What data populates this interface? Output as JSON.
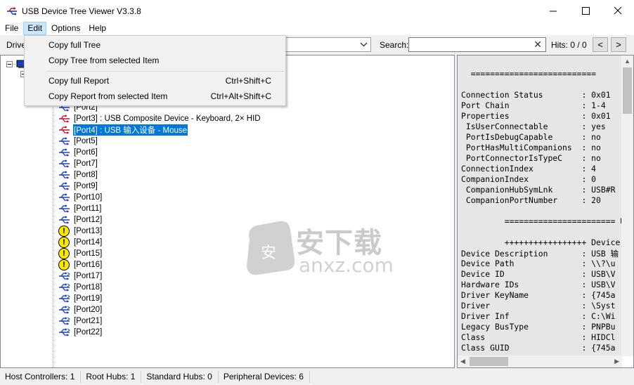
{
  "window": {
    "title": "USB Device Tree Viewer V3.3.8",
    "minimize_label": "—",
    "maximize_label": "☐",
    "close_label": "✕"
  },
  "menu": {
    "items": [
      "File",
      "Edit",
      "Options",
      "Help"
    ],
    "active_index": 1
  },
  "edit_menu": {
    "items": [
      {
        "label": "Copy full Tree",
        "shortcut": ""
      },
      {
        "label": "Copy Tree from selected Item",
        "shortcut": ""
      },
      {
        "label": "Copy full Report",
        "shortcut": "Ctrl+Shift+C"
      },
      {
        "label": "Copy Report from selected Item",
        "shortcut": "Ctrl+Alt+Shift+C"
      }
    ]
  },
  "toolbar": {
    "drive_label": "Drive",
    "search_label": "Search:",
    "search_value": "",
    "hits_label": "Hits: 0 / 0",
    "prev_label": "<",
    "next_label": ">",
    "clear_label": "✕"
  },
  "tree": {
    "ports": [
      {
        "label": "[Port2]",
        "icon": "usb-port-icon",
        "selected": false
      },
      {
        "label": "[Port3] : USB Composite Device - Keyboard, 2× HID",
        "icon": "usb-device-icon",
        "selected": false
      },
      {
        "label": "[Port4] : USB 输入设备 - Mouse",
        "icon": "usb-device-icon",
        "selected": true
      },
      {
        "label": "[Port5]",
        "icon": "usb-port-icon",
        "selected": false
      },
      {
        "label": "[Port6]",
        "icon": "usb-port-icon",
        "selected": false
      },
      {
        "label": "[Port7]",
        "icon": "usb-port-icon",
        "selected": false
      },
      {
        "label": "[Port8]",
        "icon": "usb-port-icon",
        "selected": false
      },
      {
        "label": "[Port9]",
        "icon": "usb-port-icon",
        "selected": false
      },
      {
        "label": "[Port10]",
        "icon": "usb-port-icon",
        "selected": false
      },
      {
        "label": "[Port11]",
        "icon": "usb-port-icon",
        "selected": false
      },
      {
        "label": "[Port12]",
        "icon": "usb-port-icon",
        "selected": false
      },
      {
        "label": "[Port13]",
        "icon": "warning-icon",
        "selected": false
      },
      {
        "label": "[Port14]",
        "icon": "warning-icon",
        "selected": false
      },
      {
        "label": "[Port15]",
        "icon": "warning-icon",
        "selected": false
      },
      {
        "label": "[Port16]",
        "icon": "warning-icon",
        "selected": false
      },
      {
        "label": "[Port17]",
        "icon": "usb3-port-icon",
        "selected": false
      },
      {
        "label": "[Port18]",
        "icon": "usb3-port-icon",
        "selected": false
      },
      {
        "label": "[Port19]",
        "icon": "usb3-port-icon",
        "selected": false
      },
      {
        "label": "[Port20]",
        "icon": "usb3-port-icon",
        "selected": false
      },
      {
        "label": "[Port21]",
        "icon": "usb3-port-icon",
        "selected": false
      },
      {
        "label": "[Port22]",
        "icon": "usb3-port-icon",
        "selected": false
      }
    ]
  },
  "watermark": {
    "text_cn": "安下载",
    "text_en": "anxz.com"
  },
  "report": {
    "lines": [
      "  ========================== ",
      "",
      "Connection Status        : 0x01",
      "Port Chain               : 1-4",
      "Properties               : 0x01",
      " IsUserConnectable       : yes",
      " PortIsDebugCapable      : no",
      " PortHasMultiCompanions  : no",
      " PortConnectorIsTypeC    : no",
      "ConnectionIndex          : 4",
      "CompanionIndex           : 0",
      " CompanionHubSymLnk      : USB#R",
      " CompanionPortNumber     : 20",
      "",
      "         ======================= U",
      "",
      "         +++++++++++++++++ Device",
      "Device Description       : USB 输",
      "Device Path              : \\\\?\\u",
      "Device ID                : USB\\V",
      "Hardware IDs             : USB\\V",
      "Driver KeyName           : {745a",
      "Driver                   : \\Syst",
      "Driver Inf               : C:\\Wi",
      "Legacy BusType           : PNPBu",
      "Class                    : HIDCl",
      "Class GUID               : {745a"
    ]
  },
  "status": {
    "host_controllers": "Host Controllers: 1",
    "root_hubs": "Root Hubs: 1",
    "standard_hubs": "Standard Hubs: 0",
    "peripheral_devices": "Peripheral Devices: 6"
  },
  "colors": {
    "selection": "#0078d7",
    "usb_icon_blue": "#1a3fb5",
    "usb_device_red": "#c8102e",
    "warning_yellow": "#ffe600"
  }
}
